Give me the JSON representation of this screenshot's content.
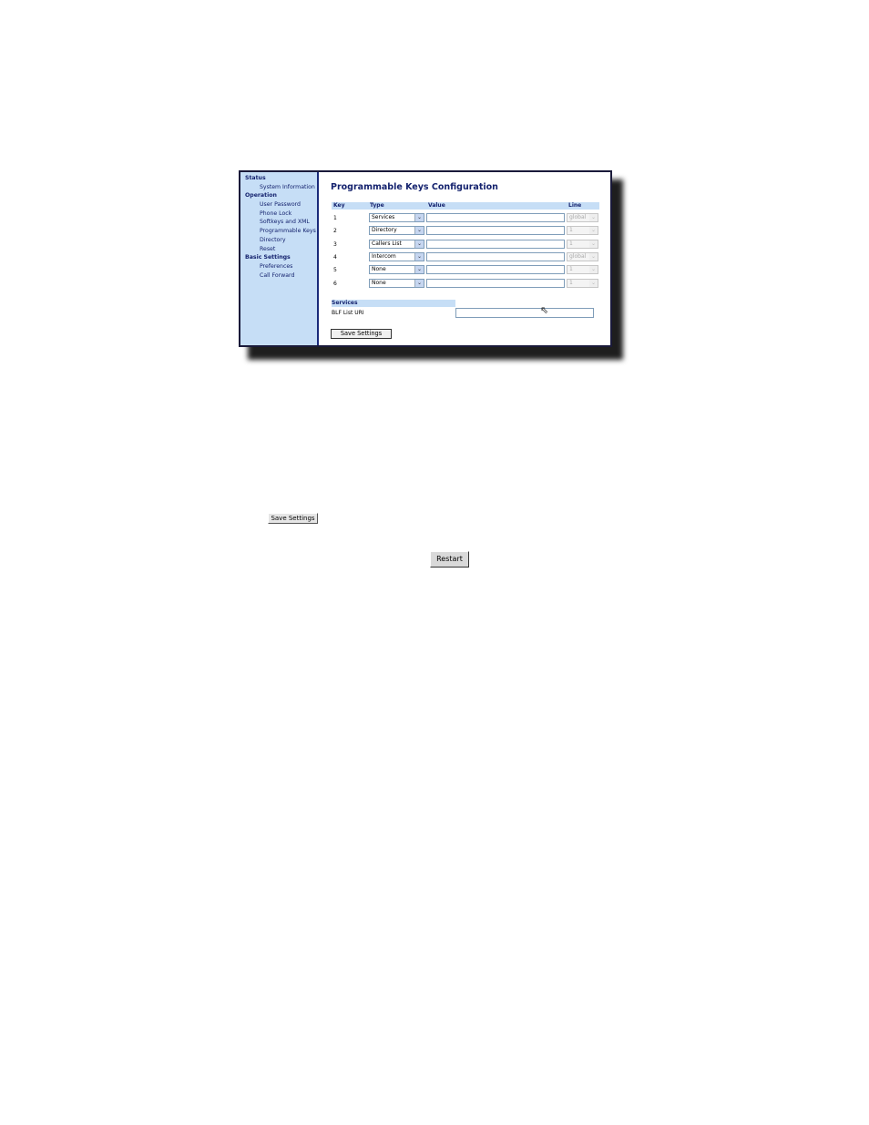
{
  "sidebar": {
    "sections": [
      {
        "title": "Status",
        "items": [
          "System Information"
        ]
      },
      {
        "title": "Operation",
        "items": [
          "User Password",
          "Phone Lock",
          "Softkeys and XML",
          "Programmable Keys",
          "Directory",
          "Reset"
        ]
      },
      {
        "title": "Basic Settings",
        "items": [
          "Preferences",
          "Call Forward"
        ]
      }
    ]
  },
  "main": {
    "title": "Programmable Keys Configuration",
    "columns": {
      "key": "Key",
      "type": "Type",
      "value": "Value",
      "line": "Line"
    },
    "rows": [
      {
        "key": "1",
        "type": "Services",
        "value": "",
        "line": "global"
      },
      {
        "key": "2",
        "type": "Directory",
        "value": "",
        "line": "1"
      },
      {
        "key": "3",
        "type": "Callers List",
        "value": "",
        "line": "1"
      },
      {
        "key": "4",
        "type": "Intercom",
        "value": "",
        "line": "global"
      },
      {
        "key": "5",
        "type": "None",
        "value": "",
        "line": "1"
      },
      {
        "key": "6",
        "type": "None",
        "value": "",
        "line": "1"
      }
    ],
    "services": {
      "header": "Services",
      "blf_label": "BLF List URI",
      "blf_value": ""
    },
    "save_label": "Save Settings"
  },
  "standalone": {
    "save_label": "Save Settings",
    "restart_label": "Restart"
  },
  "icons": {
    "dropdown": "chevron-down-icon",
    "cursor": "mouse-pointer-icon"
  }
}
